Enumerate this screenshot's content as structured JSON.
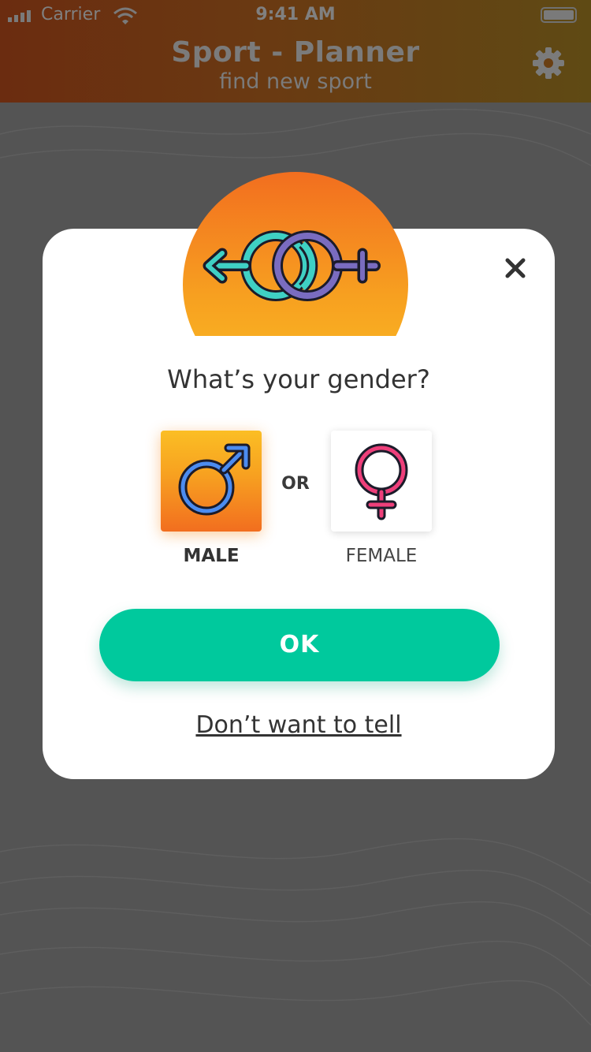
{
  "status_bar": {
    "carrier": "Carrier",
    "time": "9:41 AM"
  },
  "header": {
    "title": "Sport - Planner",
    "subtitle": "find new sport",
    "settings_icon": "gear-icon"
  },
  "dialog": {
    "hero_icon": "intertwined-gender-symbols-icon",
    "close_icon": "close-icon",
    "question": "What’s your gender?",
    "options": [
      {
        "label": "MALE",
        "icon": "male-symbol-icon",
        "selected": true
      },
      {
        "label": "FEMALE",
        "icon": "female-symbol-icon",
        "selected": false
      }
    ],
    "separator": "OR",
    "ok_label": "OK",
    "decline_label": "Don’t want to tell"
  },
  "colors": {
    "overlay": "#545454",
    "accent_orange": "#f7a020",
    "ok_button": "#00c99d",
    "male_icon": "#4c8cf0",
    "female_icon": "#ee3f7a",
    "hero_left_symbol": "#3fd0c4",
    "hero_right_symbol": "#7a6cc0"
  }
}
